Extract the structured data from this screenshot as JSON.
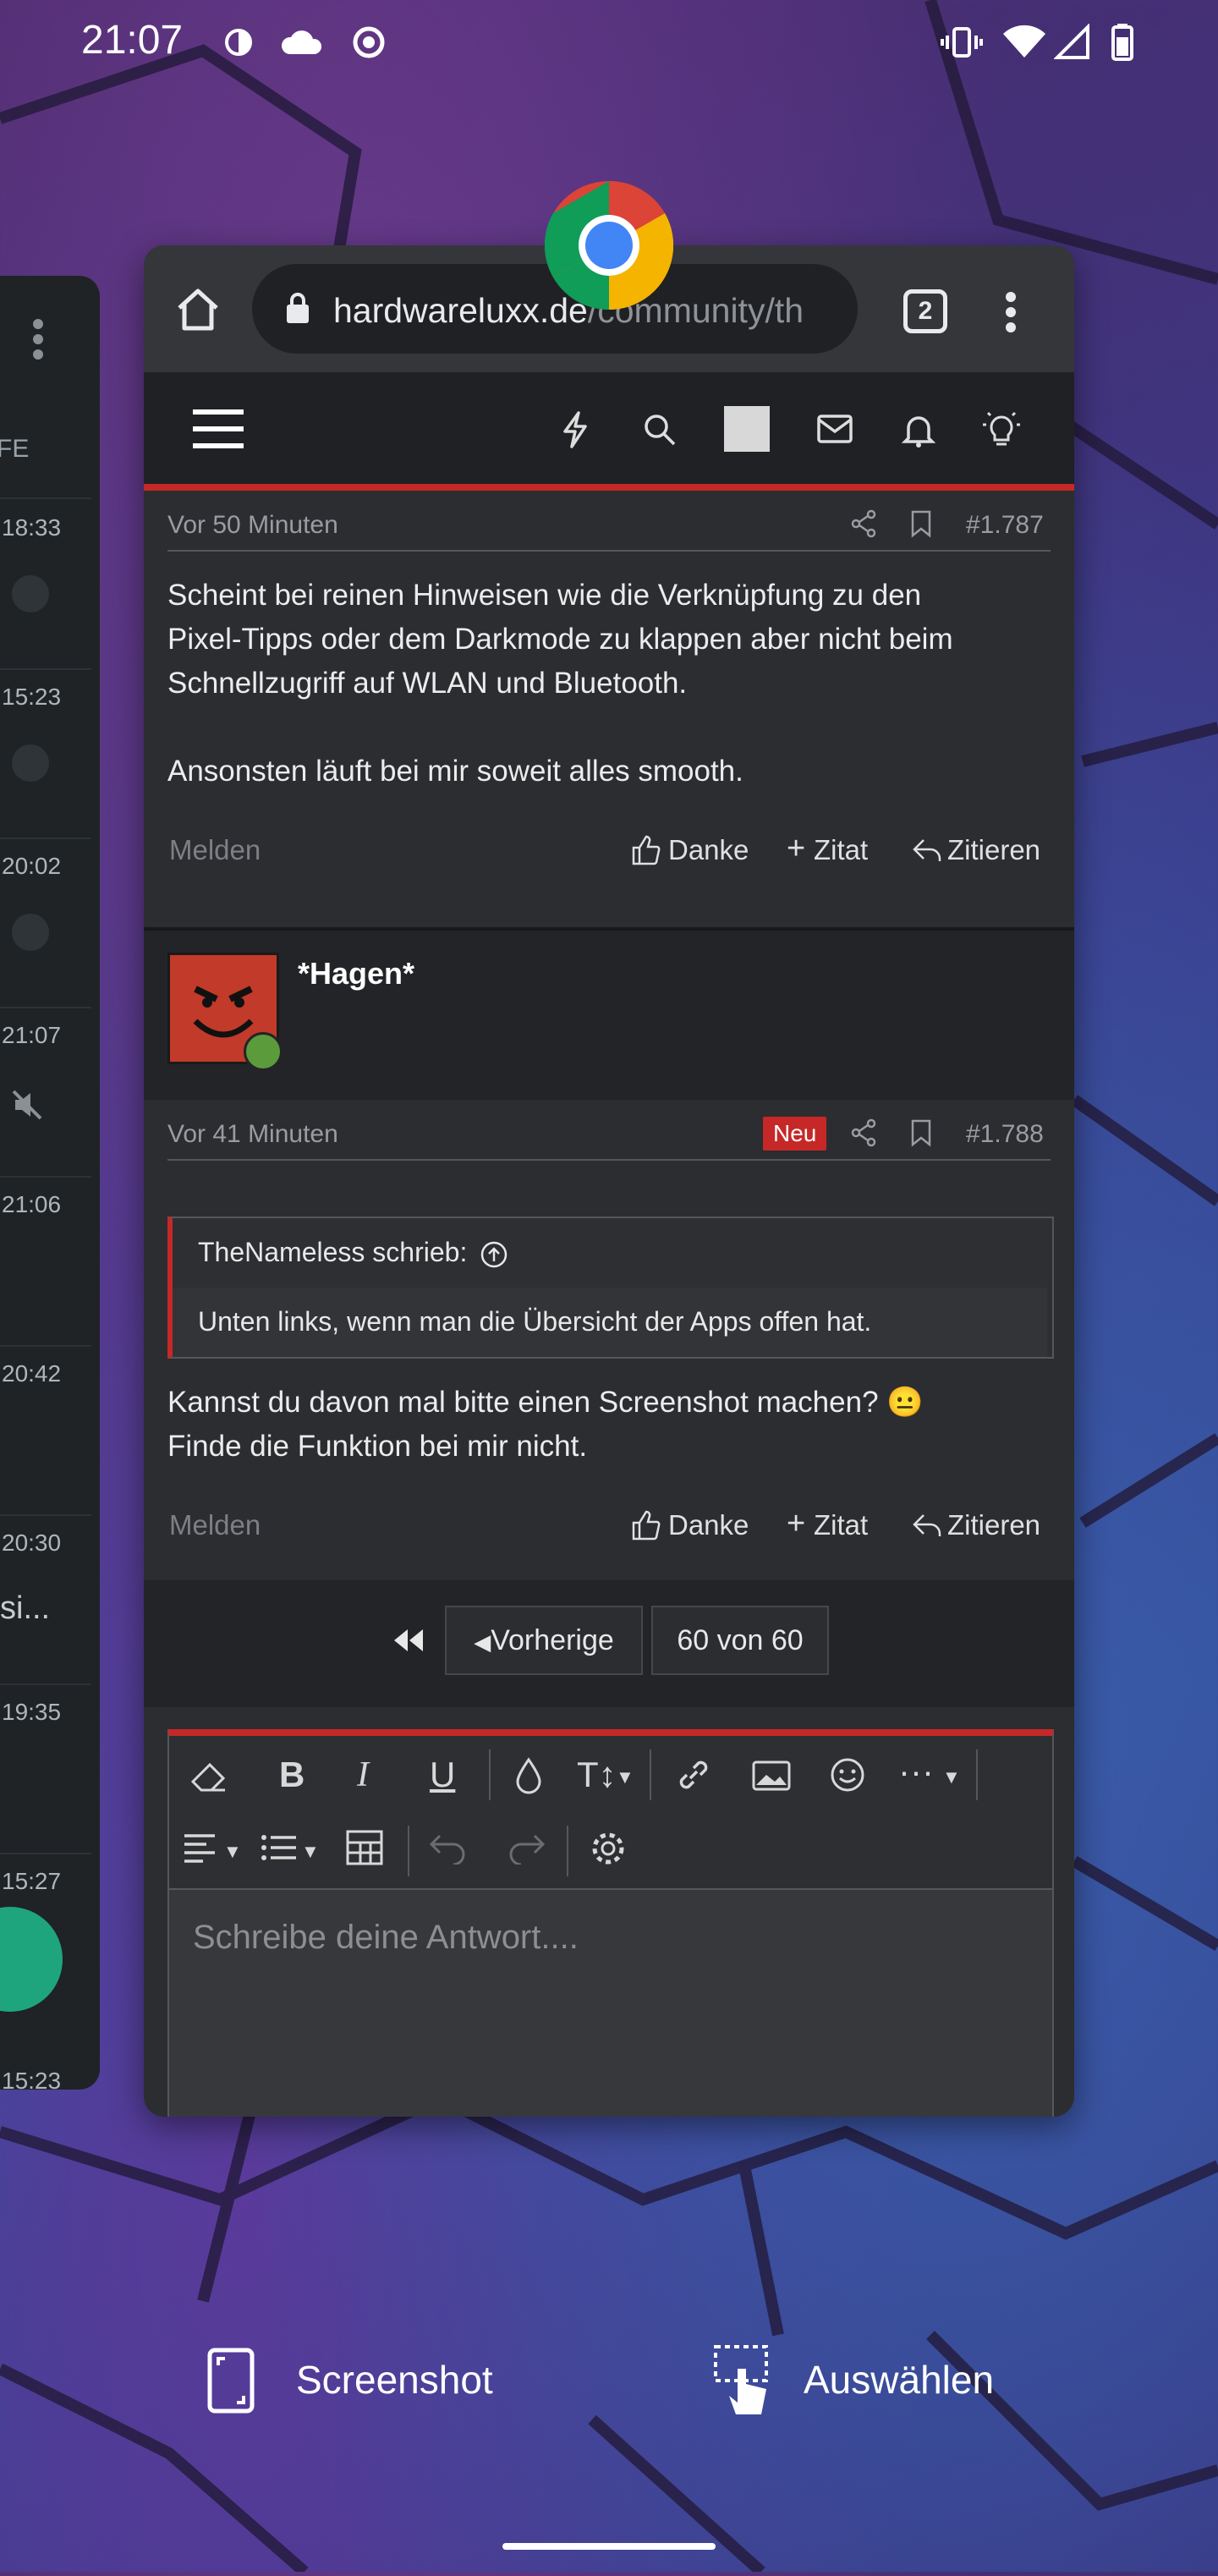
{
  "status_bar": {
    "time": "21:07",
    "icons": [
      "data-saver-icon",
      "cloud-icon",
      "record-icon",
      "vibrate-icon",
      "wifi-icon",
      "signal-icon",
      "battery-icon"
    ]
  },
  "left_card": {
    "label_partial": "FE",
    "rows": [
      {
        "time": "18:33"
      },
      {
        "time": "15:23"
      },
      {
        "time": "20:02"
      },
      {
        "time": "21:07"
      },
      {
        "time": "21:06"
      },
      {
        "time": "20:42"
      },
      {
        "time": "20:30",
        "snippet": "si..."
      },
      {
        "time": "19:35"
      },
      {
        "time": "15:27"
      },
      {
        "time": "15:23"
      }
    ]
  },
  "browser": {
    "url_host": "hardwareluxx.de",
    "url_path": "/community/th",
    "tab_count": "2"
  },
  "posts": [
    {
      "time": "Vor 50 Minuten",
      "number": "#1.787",
      "text_lines": [
        "Scheint bei reinen Hinweisen wie die Verknüpfung zu den",
        "Pixel-Tipps oder dem Darkmode zu klappen aber nicht beim",
        "Schnellzugriff auf WLAN und Bluetooth.",
        "",
        "Ansonsten läuft bei mir soweit alles smooth."
      ],
      "report": "Melden",
      "thanks": "Danke",
      "quote_add": "Zitat",
      "reply": "Zitieren"
    },
    {
      "author": "*Hagen*",
      "time": "Vor 41 Minuten",
      "badge": "Neu",
      "number": "#1.788",
      "quote_header": "TheNameless schrieb:",
      "quote_text": "Unten links, wenn man die Übersicht der Apps offen hat.",
      "text_lines": [
        "Kannst du davon mal bitte einen Screenshot machen? 😐",
        "Finde die Funktion bei mir nicht."
      ],
      "report": "Melden",
      "thanks": "Danke",
      "quote_add": "Zitat",
      "reply": "Zitieren"
    }
  ],
  "pagination": {
    "prev": "Vorherige",
    "current": "60 von 60"
  },
  "editor": {
    "placeholder": "Schreibe deine Antwort...."
  },
  "bottom_actions": {
    "screenshot": "Screenshot",
    "select": "Auswählen"
  }
}
